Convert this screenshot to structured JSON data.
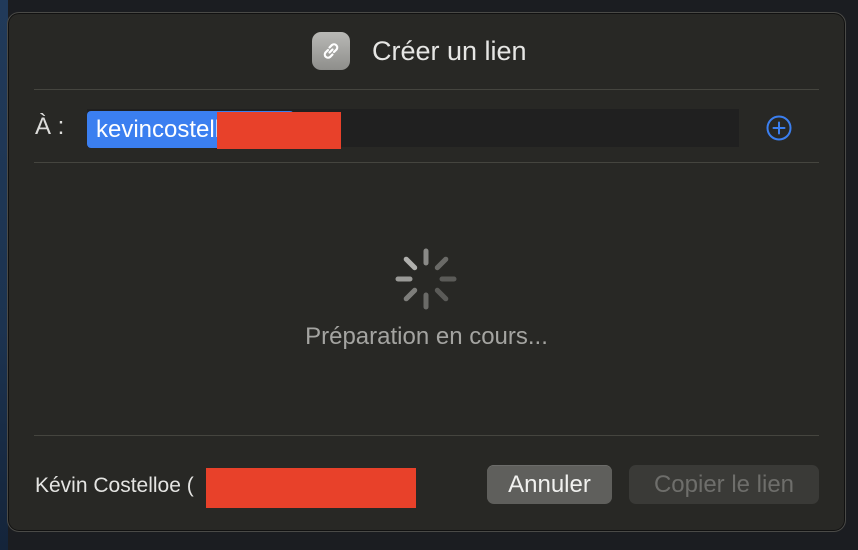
{
  "dialog": {
    "title": "Créer un lien",
    "title_icon": "link-icon"
  },
  "recipient": {
    "label": "À :",
    "token": "kevincostelloe@a",
    "add_icon": "plus-circle-icon"
  },
  "status": {
    "spinner_icon": "activity-spinner-icon",
    "message": "Préparation en cours..."
  },
  "footer": {
    "sender_name": "Kévin Costelloe (",
    "cancel_label": "Annuler",
    "copy_link_label": "Copier le lien"
  },
  "colors": {
    "accent": "#3b7ff0",
    "redaction": "#e8412a",
    "dialog_bg": "#282825"
  }
}
